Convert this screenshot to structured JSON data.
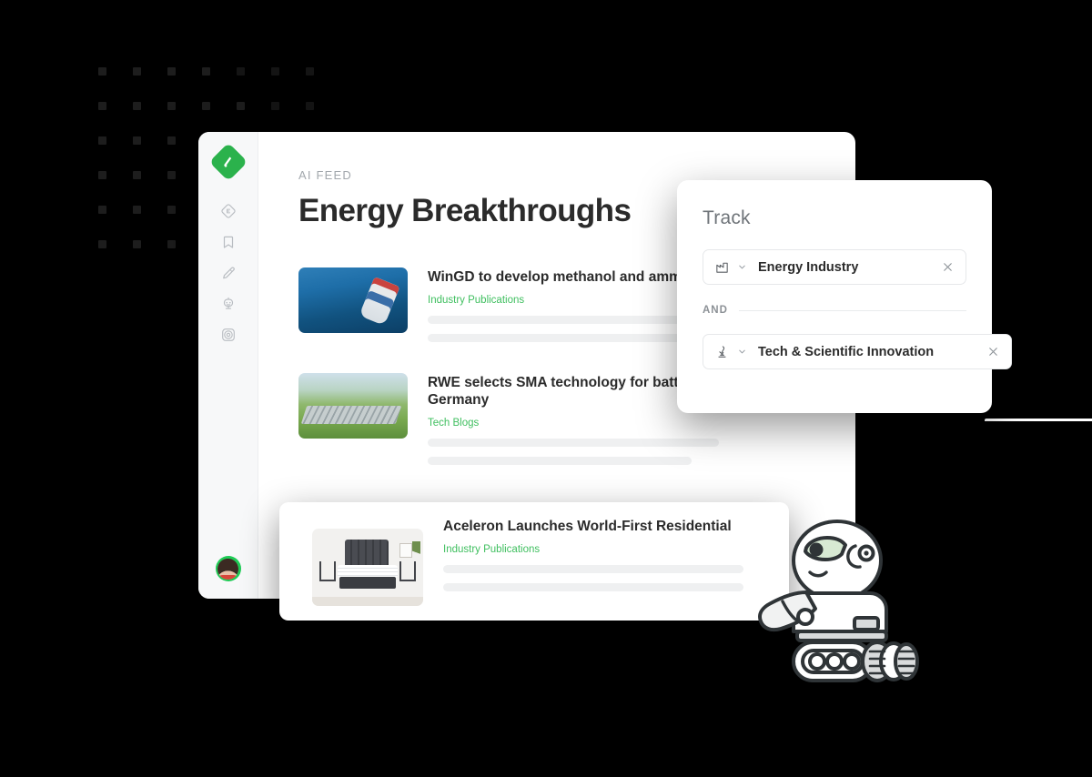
{
  "app": {
    "sidebar": {
      "logo": "feedly-logo",
      "items": [
        {
          "name": "discover-icon",
          "label": "Discover"
        },
        {
          "name": "bookmark-icon",
          "label": "Read Later"
        },
        {
          "name": "highlight-pen-icon",
          "label": "Notes & Highlights"
        },
        {
          "name": "ai-robot-icon",
          "label": "AI Feeds"
        },
        {
          "name": "lifebuoy-icon",
          "label": "Help"
        }
      ],
      "avatar_label": "User avatar"
    },
    "header": {
      "eyebrow": "AI FEED",
      "title": "Energy Breakthroughs"
    },
    "articles": [
      {
        "title": "WinGD to develop methanol and ammonia engines",
        "source": "Industry Publications",
        "thumb": "container-ship-photo"
      },
      {
        "title": "RWE selects SMA technology for battery storage facilities in Germany",
        "source": "Tech Blogs",
        "thumb": "battery-storage-field-photo"
      }
    ],
    "overlay_article": {
      "title": "Aceleron Launches World-First Residential",
      "source": "Industry Publications",
      "thumb": "bedroom-mattress-photo"
    }
  },
  "track_panel": {
    "title": "Track",
    "conjunction": "AND",
    "chips": [
      {
        "icon": "factory-icon",
        "label": "Energy Industry",
        "close": "close-icon",
        "caret": "chevron-down-icon"
      },
      {
        "icon": "microscope-icon",
        "label": "Tech & Scientific Innovation",
        "close": "close-icon",
        "caret": "chevron-down-icon"
      }
    ]
  },
  "decor": {
    "robot": "tracked-robot-illustration",
    "dot_grid": "dot-grid-pattern"
  },
  "colors": {
    "brand_green": "#2bb24c",
    "source_green": "#3fbf5f",
    "background": "#000000",
    "card": "#ffffff",
    "sidebar": "#f7f8f9",
    "text_primary": "#2b2b2b",
    "text_muted": "#a3a8ad"
  }
}
